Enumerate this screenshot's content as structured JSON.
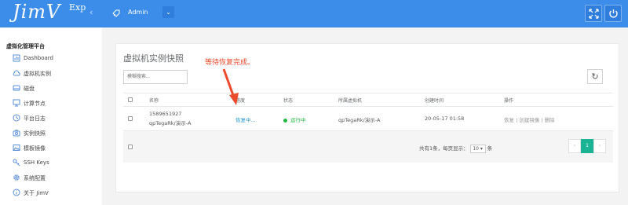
{
  "brand": {
    "name": "JimV",
    "sup": "Exp"
  },
  "header": {
    "user": "Admin",
    "collapse_glyph": "‹",
    "dropdown_glyph": "⌄",
    "icons": [
      "fullscreen-icon",
      "power-icon"
    ]
  },
  "sidebar": {
    "title": "虚拟化管理平台",
    "items": [
      {
        "label": "Dashboard",
        "icon": "gauge-icon"
      },
      {
        "label": "虚拟机实例",
        "icon": "cloud-icon"
      },
      {
        "label": "磁盘",
        "icon": "disk-icon"
      },
      {
        "label": "计算节点",
        "icon": "monitor-icon"
      },
      {
        "label": "平台日志",
        "icon": "clock-icon"
      },
      {
        "label": "实例快照",
        "icon": "camera-icon"
      },
      {
        "label": "模板镜像",
        "icon": "image-icon"
      },
      {
        "label": "SSH Keys",
        "icon": "key-icon"
      },
      {
        "label": "系统配置",
        "icon": "gear-icon"
      },
      {
        "label": "关于 JimV",
        "icon": "info-icon"
      }
    ]
  },
  "panel": {
    "title": "虚拟机实例快照",
    "annotation": "等待恢复完成。",
    "search_placeholder": "模糊搜索...",
    "refresh_glyph": "↻",
    "columns": [
      "名称",
      "进度",
      "状态",
      "所属虚拟机",
      "创建时间",
      "操作"
    ],
    "rows": [
      {
        "name": "1589651927",
        "subname": "qpTegaRk/演示-A",
        "progress": "恢复中...",
        "status": "运行中",
        "vm": "qpTegaRk/演示-A",
        "created": "20-05-17 01:58",
        "ops": [
          "恢复",
          "创建镜像",
          "删除"
        ]
      }
    ],
    "footer": {
      "summary_prefix": "共有1条，每页显示：",
      "page_size": "10",
      "summary_suffix": "条",
      "prev": "‹",
      "page": "1",
      "next": "›"
    }
  },
  "colors": {
    "header": "#3c8dea",
    "accent": "#1ab394",
    "status_green": "#1cb940",
    "annotation": "#ec4a2c",
    "link": "#2a9bd0"
  }
}
